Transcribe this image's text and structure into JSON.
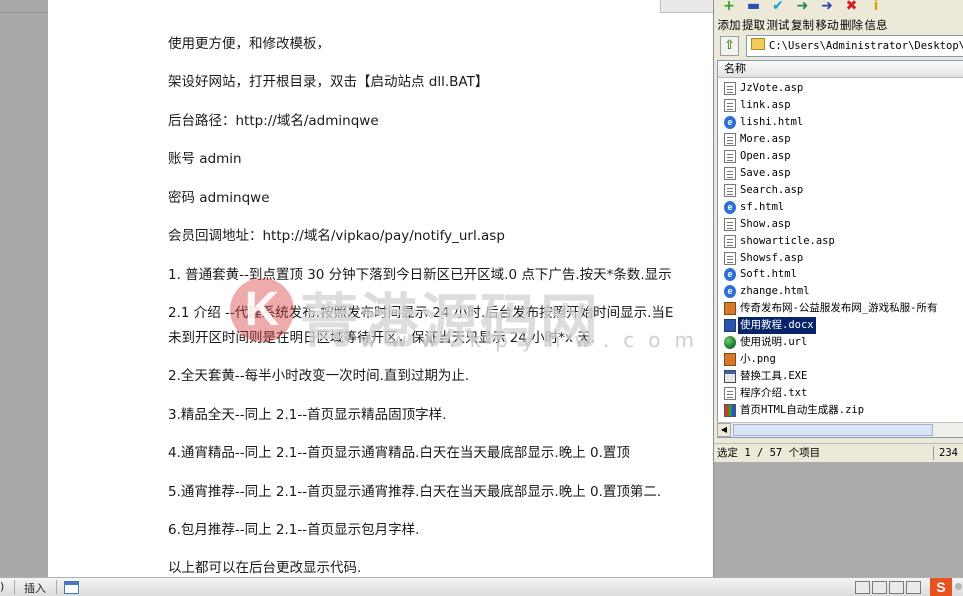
{
  "document": {
    "paragraphs": [
      "使用更方便，和修改模板，",
      "架设好网站，打开根目录，双击【启动站点 dll.BAT】",
      "后台路径：http://域名/adminqwe",
      "账号  admin",
      "密码  adminqwe",
      "会员回调地址：http://域名/vipkao/pay/notify_url.asp",
      "1. 普通套黄--到点置顶 30 分钟下落到今日新区已开区域.0 点下广告.按天*条数.显示",
      "2.1 介绍 --代理系统发布.按照发布时间显示 24 小时.后台发布按照开始时间显示.当E",
      "未到开区时间则是在明日区域等待开区，保证当天只显示 24 小时*x 天.",
      "2.全天套黄--每半小时改变一次时间.直到过期为止.",
      "3.精品全天--同上 2.1--首页显示精品固顶字样.",
      "4.通宵精品--同上 2.1--首页显示通宵精品.白天在当天最底部显示.晚上 0.置顶",
      "5.通宵推荐--同上 2.1--首页显示通宵推荐.白天在当天最底部显示.晚上 0.置顶第二.",
      "6.包月推荐--同上 2.1--首页显示包月字样.",
      "以上都可以在后台更改显示代码."
    ]
  },
  "watermark": {
    "logo_letter": "K",
    "title": "菁港源码网",
    "url": "www.kpyhw.com"
  },
  "statusbar": {
    "left_text": ")",
    "insert_label": "插入",
    "ime_label": "S"
  },
  "file_manager": {
    "toolbar": [
      {
        "label": "添加",
        "icon": "add-icon",
        "glyph": "+",
        "color": "#2e9c2e"
      },
      {
        "label": "提取",
        "icon": "extract-icon",
        "glyph": "▬",
        "color": "#2a4fb8"
      },
      {
        "label": "测试",
        "icon": "test-icon",
        "glyph": "✔",
        "color": "#1f9ad6"
      },
      {
        "label": "复制",
        "icon": "copy-icon",
        "glyph": "➜",
        "color": "#1c8a5a"
      },
      {
        "label": "移动",
        "icon": "move-icon",
        "glyph": "➜",
        "color": "#2a44b0"
      },
      {
        "label": "删除",
        "icon": "delete-icon",
        "glyph": "✖",
        "color": "#d02020"
      },
      {
        "label": "信息",
        "icon": "info-icon",
        "glyph": "i",
        "color": "#d6a500"
      }
    ],
    "path": "C:\\Users\\Administrator\\Desktop\\今",
    "column_header": "名称",
    "files": [
      {
        "name": "JzVote.asp",
        "icon": "doc"
      },
      {
        "name": "link.asp",
        "icon": "doc"
      },
      {
        "name": "lishi.html",
        "icon": "ie"
      },
      {
        "name": "More.asp",
        "icon": "doc"
      },
      {
        "name": "Open.asp",
        "icon": "doc"
      },
      {
        "name": "Save.asp",
        "icon": "doc"
      },
      {
        "name": "Search.asp",
        "icon": "doc"
      },
      {
        "name": "sf.html",
        "icon": "ie"
      },
      {
        "name": "Show.asp",
        "icon": "doc"
      },
      {
        "name": "showarticle.asp",
        "icon": "doc"
      },
      {
        "name": "Showsf.asp",
        "icon": "doc"
      },
      {
        "name": "Soft.html",
        "icon": "ie"
      },
      {
        "name": "zhange.html",
        "icon": "ie"
      },
      {
        "name": "传奇发布网-公益服发布网_游戏私服-所有",
        "icon": "img"
      },
      {
        "name": "使用教程.docx",
        "icon": "word",
        "selected": true
      },
      {
        "name": "使用说明.url",
        "icon": "globe"
      },
      {
        "name": "小.png",
        "icon": "img"
      },
      {
        "name": "替换工具.EXE",
        "icon": "exe"
      },
      {
        "name": "程序介绍.txt",
        "icon": "doc"
      },
      {
        "name": "首页HTML自动生成器.zip",
        "icon": "zip"
      }
    ],
    "status_text": "选定 1 / 57 个项目",
    "status_number": "234"
  }
}
